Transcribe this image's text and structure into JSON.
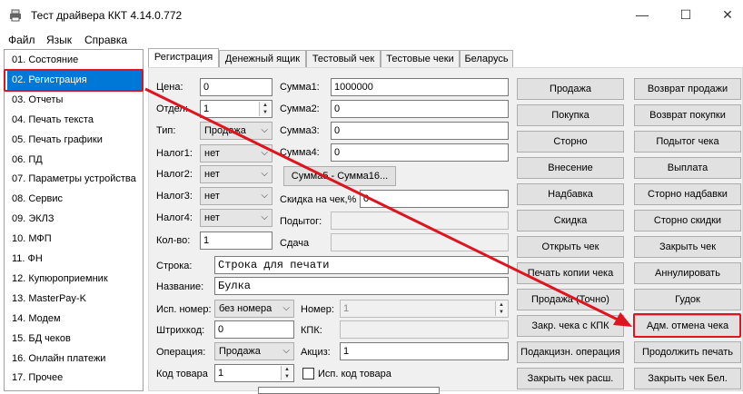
{
  "window": {
    "title": "Тест драйвера ККТ 4.14.0.772",
    "minimize": "—",
    "maximize": "☐",
    "close": "✕"
  },
  "menu": [
    "Файл",
    "Язык",
    "Справка"
  ],
  "sidebar": {
    "items": [
      "01. Состояние",
      "02. Регистрация",
      "03. Отчеты",
      "04. Печать текста",
      "05. Печать графики",
      "06. ПД",
      "07. Параметры устройства",
      "08. Сервис",
      "09. ЭКЛЗ",
      "10. МФП",
      "11. ФН",
      "12. Купюроприемник",
      "13. MasterPay-K",
      "14. Модем",
      "15. БД чеков",
      "16. Онлайн платежи",
      "17. Прочее"
    ],
    "selected_index": 1
  },
  "tabs": [
    "Регистрация",
    "Денежный ящик",
    "Тестовый чек",
    "Тестовые чеки",
    "Беларусь"
  ],
  "form": {
    "price_label": "Цена:",
    "price_value": "0",
    "dept_label": "Отдел:",
    "dept_value": "1",
    "type_label": "Тип:",
    "type_value": "Продажа",
    "tax1_label": "Налог1:",
    "tax1_value": "нет",
    "tax2_label": "Налог2:",
    "tax2_value": "нет",
    "tax3_label": "Налог3:",
    "tax3_value": "нет",
    "tax4_label": "Налог4:",
    "tax4_value": "нет",
    "qty_label": "Кол-во:",
    "qty_value": "1",
    "sum1_label": "Сумма1:",
    "sum1_value": "1000000",
    "sum2_label": "Сумма2:",
    "sum2_value": "0",
    "sum3_label": "Сумма3:",
    "sum3_value": "0",
    "sum4_label": "Сумма4:",
    "sum4_value": "0",
    "sum5_button": "Сумма5 - Сумма16...",
    "discount_label": "Скидка на чек,%",
    "discount_value": "0",
    "subtotal_label": "Подытог:",
    "subtotal_value": "",
    "change_label": "Сдача",
    "change_value": "",
    "line_label": "Строка:",
    "line_value": "Строка для печати",
    "name_label": "Название:",
    "name_value": "Булка",
    "exec_label": "Исп. номер:",
    "exec_value": "без номера",
    "number_label": "Номер:",
    "number_value": "1",
    "barcode_label": "Штрихкод:",
    "barcode_value": "0",
    "kpk_label": "КПК:",
    "kpk_value": "",
    "op_label": "Операция:",
    "op_value": "Продажа",
    "excise_label": "Акциз:",
    "excise_value": "1",
    "code_label": "Код товара",
    "code_value": "1",
    "use_code_label": "Исп. код товара"
  },
  "buttons_left": [
    "Продажа",
    "Покупка",
    "Сторно",
    "Внесение",
    "Надбавка",
    "Скидка",
    "Открыть чек",
    "Печать копии чека",
    "Продажа (Точно)",
    "Закр. чека с КПК",
    "Подакцизн. операция",
    "Закрыть чек расш."
  ],
  "buttons_right": [
    "Возврат продажи",
    "Возврат покупки",
    "Подытог чека",
    "Выплата",
    "Сторно надбавки",
    "Сторно скидки",
    "Закрыть чек",
    "Аннулировать",
    "Гудок",
    "Адм. отмена чека",
    "Продолжить печать",
    "Закрыть чек Бел."
  ],
  "icons": {
    "app": "printer-icon",
    "spin": "spinner-arrows-icon",
    "chevron": "chevron-down-icon"
  },
  "colors": {
    "highlight": "#0078d7",
    "annotation": "#e0141e"
  }
}
